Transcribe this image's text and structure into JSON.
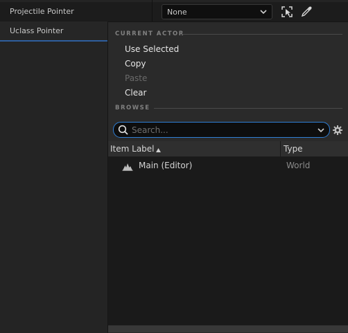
{
  "details": {
    "rows": [
      {
        "label": "Projectile Pointer"
      },
      {
        "label": "Uclass Pointer"
      }
    ],
    "combo_value": "None"
  },
  "popup": {
    "current_actor_header": "CURRENT ACTOR",
    "menu": {
      "use_selected": "Use Selected",
      "copy": "Copy",
      "paste": "Paste",
      "clear": "Clear"
    },
    "browse_header": "BROWSE",
    "search": {
      "placeholder": "Search..."
    },
    "table": {
      "headers": {
        "item_label": "Item Label",
        "type": "Type"
      },
      "rows": [
        {
          "label": "Main (Editor)",
          "type": "World"
        }
      ]
    }
  },
  "colors": {
    "accent": "#2f7fd6",
    "background": "#242424"
  }
}
